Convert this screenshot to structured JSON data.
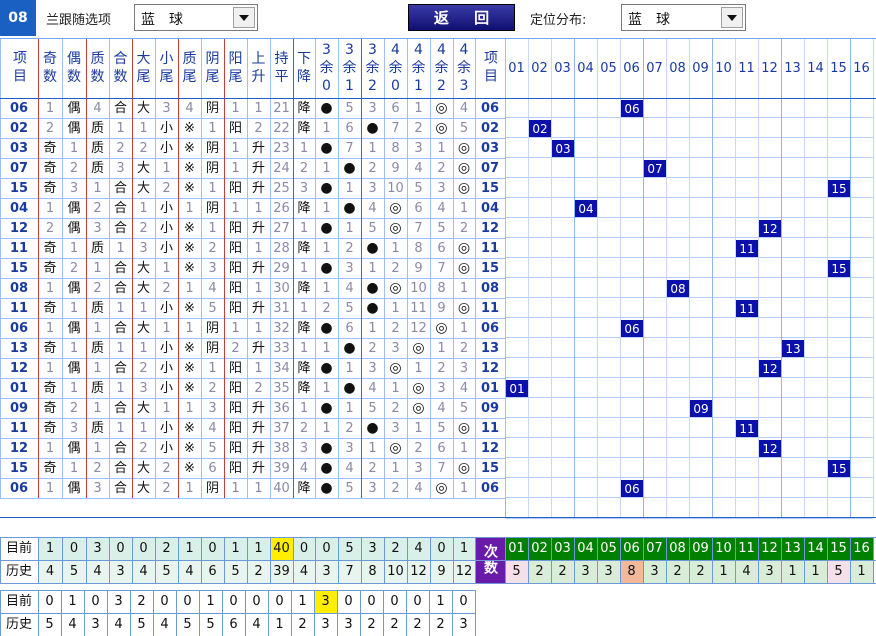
{
  "topbar": {
    "badge": "08",
    "follow_label": "兰跟随选项",
    "follow_value": "蓝球",
    "back_label": "返 回",
    "position_label": "定位分布:",
    "position_value": "蓝球"
  },
  "colors": {
    "accent_blue": "#1a5fc2",
    "marker": "#0a10a8",
    "grid": "#6fa6ff",
    "stat_head": "#008000",
    "stat_cell": "#b8e8c0",
    "count_head": "#6a1aa8",
    "highlight": "#ffee00",
    "stat_peach": "#f3b89a",
    "stat_pink": "#f7c8d8",
    "stat_cyan": "#c8f0f0"
  },
  "header": {
    "item": "项目",
    "cols": [
      "奇数",
      "偶数",
      "质数",
      "合数",
      "大尾",
      "小尾",
      "质尾",
      "阴尾",
      "阳尾",
      "上升",
      "持平",
      "下降",
      "3余0",
      "3余1",
      "3余2",
      "4余0",
      "4余1",
      "4余2",
      "4余3"
    ],
    "item2": "项目",
    "nums": [
      "01",
      "02",
      "03",
      "04",
      "05",
      "06",
      "07",
      "08",
      "09",
      "10",
      "11",
      "12",
      "13",
      "14",
      "15",
      "16"
    ]
  },
  "rows": [
    {
      "n": "06",
      "c": [
        "1",
        "偶",
        "4",
        "合",
        "大",
        "3",
        "4",
        "阴",
        "1",
        "1",
        "21",
        "降",
        "●",
        "5",
        "3",
        "6",
        "1",
        "◎",
        "4"
      ]
    },
    {
      "n": "02",
      "c": [
        "2",
        "偶",
        "质",
        "1",
        "1",
        "小",
        "※",
        "1",
        "阳",
        "2",
        "22",
        "降",
        "1",
        "6",
        "●",
        "7",
        "2",
        "◎",
        "5"
      ]
    },
    {
      "n": "03",
      "c": [
        "奇",
        "1",
        "质",
        "2",
        "2",
        "小",
        "※",
        "阴",
        "1",
        "升",
        "23",
        "1",
        "●",
        "7",
        "1",
        "8",
        "3",
        "1",
        "◎"
      ]
    },
    {
      "n": "07",
      "c": [
        "奇",
        "2",
        "质",
        "3",
        "大",
        "1",
        "※",
        "阴",
        "1",
        "升",
        "24",
        "2",
        "1",
        "●",
        "2",
        "9",
        "4",
        "2",
        "◎"
      ]
    },
    {
      "n": "15",
      "c": [
        "奇",
        "3",
        "1",
        "合",
        "大",
        "2",
        "※",
        "1",
        "阳",
        "升",
        "25",
        "3",
        "●",
        "1",
        "3",
        "10",
        "5",
        "3",
        "◎"
      ]
    },
    {
      "n": "04",
      "c": [
        "1",
        "偶",
        "2",
        "合",
        "1",
        "小",
        "1",
        "阴",
        "1",
        "1",
        "26",
        "降",
        "1",
        "●",
        "4",
        "◎",
        "6",
        "4",
        "1"
      ]
    },
    {
      "n": "12",
      "c": [
        "2",
        "偶",
        "3",
        "合",
        "2",
        "小",
        "※",
        "1",
        "阳",
        "升",
        "27",
        "1",
        "●",
        "1",
        "5",
        "◎",
        "7",
        "5",
        "2"
      ]
    },
    {
      "n": "11",
      "c": [
        "奇",
        "1",
        "质",
        "1",
        "3",
        "小",
        "※",
        "2",
        "阳",
        "1",
        "28",
        "降",
        "1",
        "2",
        "●",
        "1",
        "8",
        "6",
        "◎"
      ]
    },
    {
      "n": "15",
      "c": [
        "奇",
        "2",
        "1",
        "合",
        "大",
        "1",
        "※",
        "3",
        "阳",
        "升",
        "29",
        "1",
        "●",
        "3",
        "1",
        "2",
        "9",
        "7",
        "◎"
      ]
    },
    {
      "n": "08",
      "c": [
        "1",
        "偶",
        "2",
        "合",
        "大",
        "2",
        "1",
        "4",
        "阳",
        "1",
        "30",
        "降",
        "1",
        "4",
        "●",
        "◎",
        "10",
        "8",
        "1"
      ]
    },
    {
      "n": "11",
      "c": [
        "奇",
        "1",
        "质",
        "1",
        "1",
        "小",
        "※",
        "5",
        "阳",
        "升",
        "31",
        "1",
        "2",
        "5",
        "●",
        "1",
        "11",
        "9",
        "◎"
      ]
    },
    {
      "n": "06",
      "c": [
        "1",
        "偶",
        "1",
        "合",
        "大",
        "1",
        "1",
        "阴",
        "1",
        "1",
        "32",
        "降",
        "●",
        "6",
        "1",
        "2",
        "12",
        "◎",
        "1"
      ]
    },
    {
      "n": "13",
      "c": [
        "奇",
        "1",
        "质",
        "1",
        "1",
        "小",
        "※",
        "阴",
        "2",
        "升",
        "33",
        "1",
        "1",
        "●",
        "2",
        "3",
        "◎",
        "1",
        "2"
      ]
    },
    {
      "n": "12",
      "c": [
        "1",
        "偶",
        "1",
        "合",
        "2",
        "小",
        "※",
        "1",
        "阳",
        "1",
        "34",
        "降",
        "●",
        "1",
        "3",
        "◎",
        "1",
        "2",
        "3"
      ]
    },
    {
      "n": "01",
      "c": [
        "奇",
        "1",
        "质",
        "1",
        "3",
        "小",
        "※",
        "2",
        "阳",
        "2",
        "35",
        "降",
        "1",
        "●",
        "4",
        "1",
        "◎",
        "3",
        "4"
      ]
    },
    {
      "n": "09",
      "c": [
        "奇",
        "2",
        "1",
        "合",
        "大",
        "1",
        "1",
        "3",
        "阳",
        "升",
        "36",
        "1",
        "●",
        "1",
        "5",
        "2",
        "◎",
        "4",
        "5"
      ]
    },
    {
      "n": "11",
      "c": [
        "奇",
        "3",
        "质",
        "1",
        "1",
        "小",
        "※",
        "4",
        "阳",
        "升",
        "37",
        "2",
        "1",
        "2",
        "●",
        "3",
        "1",
        "5",
        "◎"
      ]
    },
    {
      "n": "12",
      "c": [
        "1",
        "偶",
        "1",
        "合",
        "2",
        "小",
        "※",
        "5",
        "阳",
        "升",
        "38",
        "3",
        "●",
        "3",
        "1",
        "◎",
        "2",
        "6",
        "1"
      ]
    },
    {
      "n": "15",
      "c": [
        "奇",
        "1",
        "2",
        "合",
        "大",
        "2",
        "※",
        "6",
        "阳",
        "升",
        "39",
        "4",
        "●",
        "4",
        "2",
        "1",
        "3",
        "7",
        "◎"
      ]
    },
    {
      "n": "06",
      "c": [
        "1",
        "偶",
        "3",
        "合",
        "大",
        "2",
        "1",
        "阴",
        "1",
        "1",
        "40",
        "降",
        "●",
        "5",
        "3",
        "2",
        "4",
        "◎",
        "1"
      ]
    }
  ],
  "stats": {
    "current_label": "目前",
    "history_label": "历史",
    "current": [
      "1",
      "0",
      "3",
      "0",
      "0",
      "2",
      "1",
      "0",
      "1",
      "1",
      "40",
      "0",
      "0",
      "5",
      "3",
      "2",
      "4",
      "0",
      "1"
    ],
    "history": [
      "4",
      "5",
      "4",
      "3",
      "4",
      "5",
      "4",
      "6",
      "5",
      "2",
      "39",
      "4",
      "3",
      "7",
      "8",
      "10",
      "12",
      "9",
      "12"
    ],
    "count_label": "次数",
    "count_nums": [
      "01",
      "02",
      "03",
      "04",
      "05",
      "06",
      "07",
      "08",
      "09",
      "10",
      "11",
      "12",
      "13",
      "14",
      "15",
      "16"
    ],
    "count_values": [
      "5",
      "2",
      "2",
      "3",
      "3",
      "8",
      "3",
      "2",
      "2",
      "1",
      "4",
      "3",
      "1",
      "1",
      "5",
      "1"
    ]
  },
  "bottom": {
    "current_label": "目前",
    "history_label": "历史",
    "current": [
      "0",
      "1",
      "0",
      "3",
      "2",
      "0",
      "0",
      "1",
      "0",
      "0",
      "0",
      "1",
      "3",
      "0",
      "0",
      "0",
      "0",
      "1",
      "0"
    ],
    "history": [
      "5",
      "4",
      "3",
      "4",
      "5",
      "4",
      "5",
      "5",
      "6",
      "4",
      "1",
      "2",
      "3",
      "3",
      "2",
      "2",
      "2",
      "2",
      "3"
    ]
  }
}
